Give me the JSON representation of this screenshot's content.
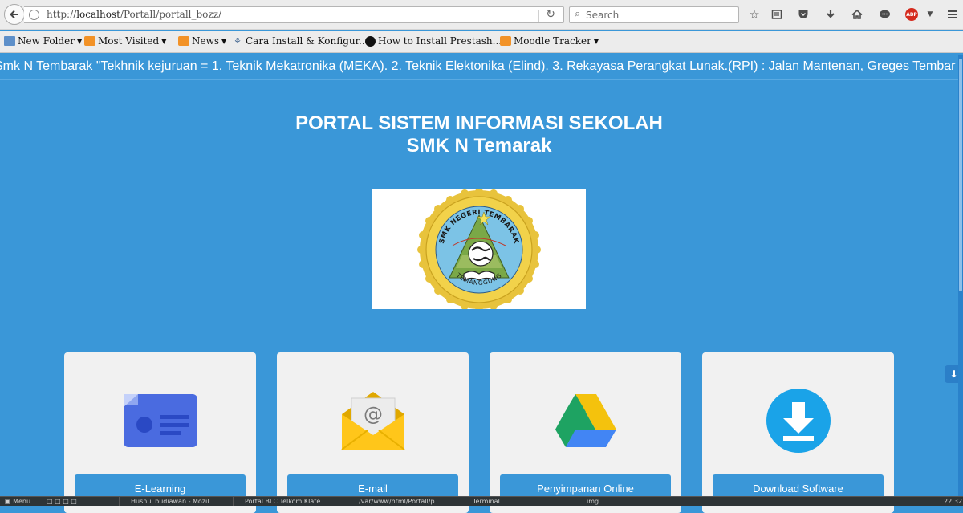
{
  "browser": {
    "url_prefix": "http://",
    "url_host": "localhost",
    "url_path": "/Portall/portall_bozz/",
    "search_placeholder": "Search",
    "abp_label": "ABP"
  },
  "bookmarks": [
    {
      "label": "New Folder",
      "icon": "folder-icon",
      "dropdown": true
    },
    {
      "label": "Most Visited",
      "icon": "rss-icon",
      "dropdown": true
    },
    {
      "label": "News",
      "icon": "rss-icon",
      "dropdown": true
    },
    {
      "label": "Cara Install & Konfigur...",
      "icon": "wiki-icon",
      "dropdown": false
    },
    {
      "label": "How to Install Prestash...",
      "icon": "github-icon",
      "dropdown": false
    },
    {
      "label": "Moodle Tracker",
      "icon": "rss-icon",
      "dropdown": true
    }
  ],
  "page": {
    "marquee": "Smk N Tembarak \"Tekhnik kejuruan = 1. Teknik Mekatronika (MEKA). 2. Teknik Elektonika (Elind). 3. Rekayasa Perangkat Lunak.(RPI) : Jalan Mantenan, Greges Tembar",
    "title_line1": "PORTAL SISTEM INFORMASI SEKOLAH",
    "title_line2": "SMK N Temarak",
    "logo": {
      "top_text": "SMK NEGERI TEMBARAK",
      "bottom_text": "TEMANGGUNG"
    },
    "cards": [
      {
        "label": "E-Learning",
        "icon": "e-learning-icon"
      },
      {
        "label": "E-mail",
        "icon": "email-icon"
      },
      {
        "label": "Penyimpanan Online",
        "icon": "google-drive-icon"
      },
      {
        "label": "Download Software",
        "icon": "download-icon"
      }
    ]
  },
  "taskbar": {
    "menu": "Menu",
    "tasks": [
      "Husnul budiawan - Mozil...",
      "Portal BLC Telkom Klate...",
      "/var/www/html/Portall/p...",
      "Terminal",
      "img"
    ],
    "clock": "22:32"
  },
  "colors": {
    "page_bg": "#3a97d8",
    "card_bg": "#f1f1f1",
    "button_bg": "#3a97d8"
  }
}
